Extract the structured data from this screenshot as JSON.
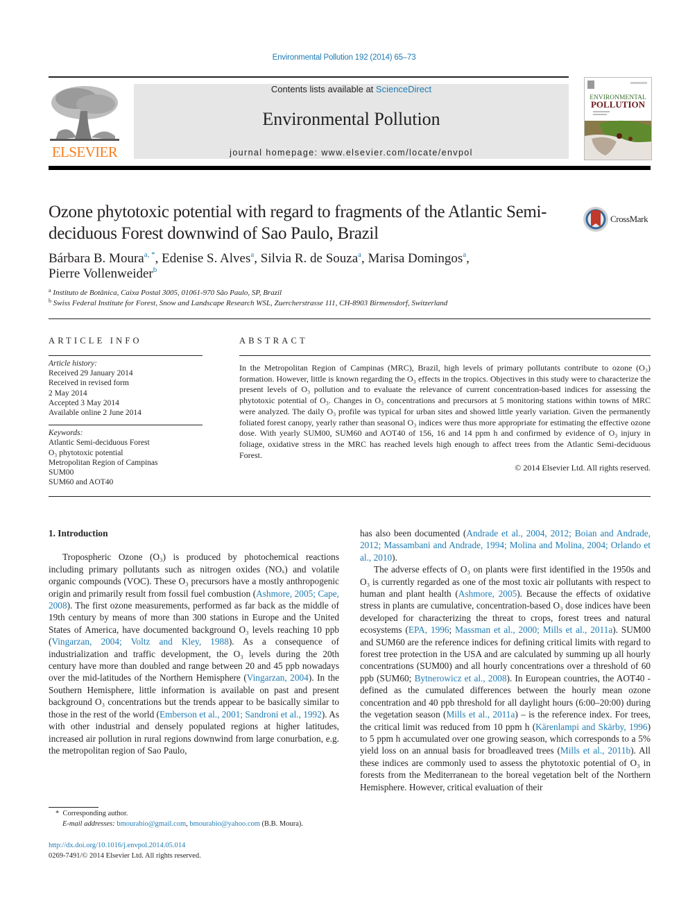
{
  "header": {
    "citation": "Environmental Pollution 192 (2014) 65–73",
    "contents_prefix": "Contents lists available at ",
    "contents_link": "ScienceDirect",
    "journal_name": "Environmental Pollution",
    "homepage": "journal homepage: www.elsevier.com/locate/envpol",
    "publisher_logo_text": "ELSEVIER",
    "cover": {
      "line1": "ENVIRONMENTAL",
      "line2": "POLLUTION"
    },
    "colors": {
      "link": "#1e7bb3",
      "elsevier_orange": "#f57f20",
      "masthead_bg": "#e6e6e6"
    }
  },
  "article": {
    "title": "Ozone phytotoxic potential with regard to fragments of the Atlantic Semi-deciduous Forest downwind of Sao Paulo, Brazil",
    "crossmark_label": "CrossMark",
    "authors": [
      {
        "name": "Bárbara B. Moura",
        "sup": "a, *"
      },
      {
        "name": "Edenise S. Alves",
        "sup": "a"
      },
      {
        "name": "Silvia R. de Souza",
        "sup": "a"
      },
      {
        "name": "Marisa Domingos",
        "sup": "a"
      },
      {
        "name": "Pierre Vollenweider",
        "sup": "b"
      }
    ],
    "affiliations": [
      {
        "sup": "a",
        "text": "Instituto de Botânica, Caixa Postal 3005, 01061-970 São Paulo, SP, Brazil"
      },
      {
        "sup": "b",
        "text": "Swiss Federal Institute for Forest, Snow and Landscape Research WSL, Zuercherstrasse 111, CH-8903 Birmensdorf, Switzerland"
      }
    ]
  },
  "article_info": {
    "heading": "ARTICLE INFO",
    "history_label": "Article history:",
    "history": [
      "Received 29 January 2014",
      "Received in revised form",
      "2 May 2014",
      "Accepted 3 May 2014",
      "Available online 2 June 2014"
    ],
    "keywords_label": "Keywords:",
    "keywords": [
      "Atlantic Semi-deciduous Forest",
      "O₃ phytotoxic potential",
      "Metropolitan Region of Campinas",
      "SUM00",
      "SUM60 and AOT40"
    ]
  },
  "abstract": {
    "heading": "ABSTRACT",
    "text": "In the Metropolitan Region of Campinas (MRC), Brazil, high levels of primary pollutants contribute to ozone (O₃) formation. However, little is known regarding the O₃ effects in the tropics. Objectives in this study were to characterize the present levels of O₃ pollution and to evaluate the relevance of current concentration-based indices for assessing the phytotoxic potential of O₃. Changes in O₃ concentrations and precursors at 5 monitoring stations within towns of MRC were analyzed. The daily O₃ profile was typical for urban sites and showed little yearly variation. Given the permanently foliated forest canopy, yearly rather than seasonal O₃ indices were thus more appropriate for estimating the effective ozone dose. With yearly SUM00, SUM60 and AOT40 of 156, 16 and 14 ppm h and confirmed by evidence of O₃ injury in foliage, oxidative stress in the MRC has reached levels high enough to affect trees from the Atlantic Semi-deciduous Forest.",
    "copyright": "© 2014 Elsevier Ltd. All rights reserved."
  },
  "body": {
    "section_heading": "1.  Introduction",
    "left_paragraphs": [
      [
        {
          "t": "Tropospheric Ozone (O₃) is produced by photochemical reactions including primary pollutants such as nitrogen oxides (NOₓ) and volatile organic compounds (VOC). These O₃ precursors have a mostly anthropogenic origin and primarily result from fossil fuel combustion ("
        },
        {
          "t": "Ashmore, 2005; Cape, 2008",
          "link": true
        },
        {
          "t": "). The first ozone measurements, performed as far back as the middle of 19th century by means of more than 300 stations in Europe and the United States of America, have documented background O₃ levels reaching 10 ppb ("
        },
        {
          "t": "Vingarzan, 2004; Voltz and Kley, 1988",
          "link": true
        },
        {
          "t": "). As a consequence of industrialization and traffic development, the O₃ levels during the 20th century have more than doubled and range between 20 and 45 ppb nowadays over the mid-latitudes of the Northern Hemisphere ("
        },
        {
          "t": "Vingarzan, 2004",
          "link": true
        },
        {
          "t": "). In the Southern Hemisphere, little information is available on past and present background O₃ concentrations but the trends appear to be basically similar to those in the rest of the world ("
        },
        {
          "t": "Emberson et al., 2001; Sandroni et al., 1992",
          "link": true
        },
        {
          "t": "). As with other industrial and densely populated regions at higher latitudes, increased air pollution in rural regions downwind from large conurbation, e.g. the metropolitan region of Sao Paulo,"
        }
      ]
    ],
    "right_paragraphs": [
      [
        {
          "t": "has also been documented ("
        },
        {
          "t": "Andrade et al., 2004, 2012; Boian and Andrade, 2012; Massambani and Andrade, 1994; Molina and Molina, 2004; Orlando et al., 2010",
          "link": true
        },
        {
          "t": ")."
        }
      ],
      [
        {
          "t": "The adverse effects of O₃ on plants were first identified in the 1950s and O₃ is currently regarded as one of the most toxic air pollutants with respect to human and plant health ("
        },
        {
          "t": "Ashmore, 2005",
          "link": true
        },
        {
          "t": "). Because the effects of oxidative stress in plants are cumulative, concentration-based O₃ dose indices have been developed for characterizing the threat to crops, forest trees and natural ecosystems ("
        },
        {
          "t": "EPA, 1996",
          "link": true
        },
        {
          "t": "; "
        },
        {
          "t": "Massman et al., 2000; Mills et al., 2011a",
          "link": true
        },
        {
          "t": "). SUM00 and SUM60 are the reference indices for defining critical limits with regard to forest tree protection in the USA and are calculated by summing up all hourly concentrations (SUM00) and all hourly concentrations over a threshold of 60 ppb (SUM60; "
        },
        {
          "t": "Bytnerowicz et al., 2008",
          "link": true
        },
        {
          "t": "). In European countries, the AOT40 - defined as the cumulated differences between the hourly mean ozone concentration and 40 ppb threshold for all daylight hours (6:00–20:00) during the vegetation season ("
        },
        {
          "t": "Mills et al., 2011a",
          "link": true
        },
        {
          "t": ") – is the reference index. For trees, the critical limit was reduced from 10 ppm h ("
        },
        {
          "t": "Kärenlampi and Skärby, 1996",
          "link": true
        },
        {
          "t": ") to 5 ppm h accumulated over one growing season, which corresponds to a 5% yield loss on an annual basis for broadleaved trees ("
        },
        {
          "t": "Mills et al., 2011b",
          "link": true
        },
        {
          "t": "). All these indices are commonly used to assess the phytotoxic potential of O₃ in forests from the Mediterranean to the boreal vegetation belt of the Northern Hemisphere. However, critical evaluation of their"
        }
      ]
    ]
  },
  "footnote": {
    "star": "*",
    "corresponding": "Corresponding author.",
    "email_label": "E-mail addresses:",
    "email1": "bmourabio@gmail.com",
    "sep": ", ",
    "email2": "bmourabio@yahoo.com",
    "email_suffix": " (B.B. Moura)."
  },
  "doi": {
    "url": "http://dx.doi.org/10.1016/j.envpol.2014.05.014",
    "issn_line": "0269-7491/© 2014 Elsevier Ltd. All rights reserved."
  }
}
